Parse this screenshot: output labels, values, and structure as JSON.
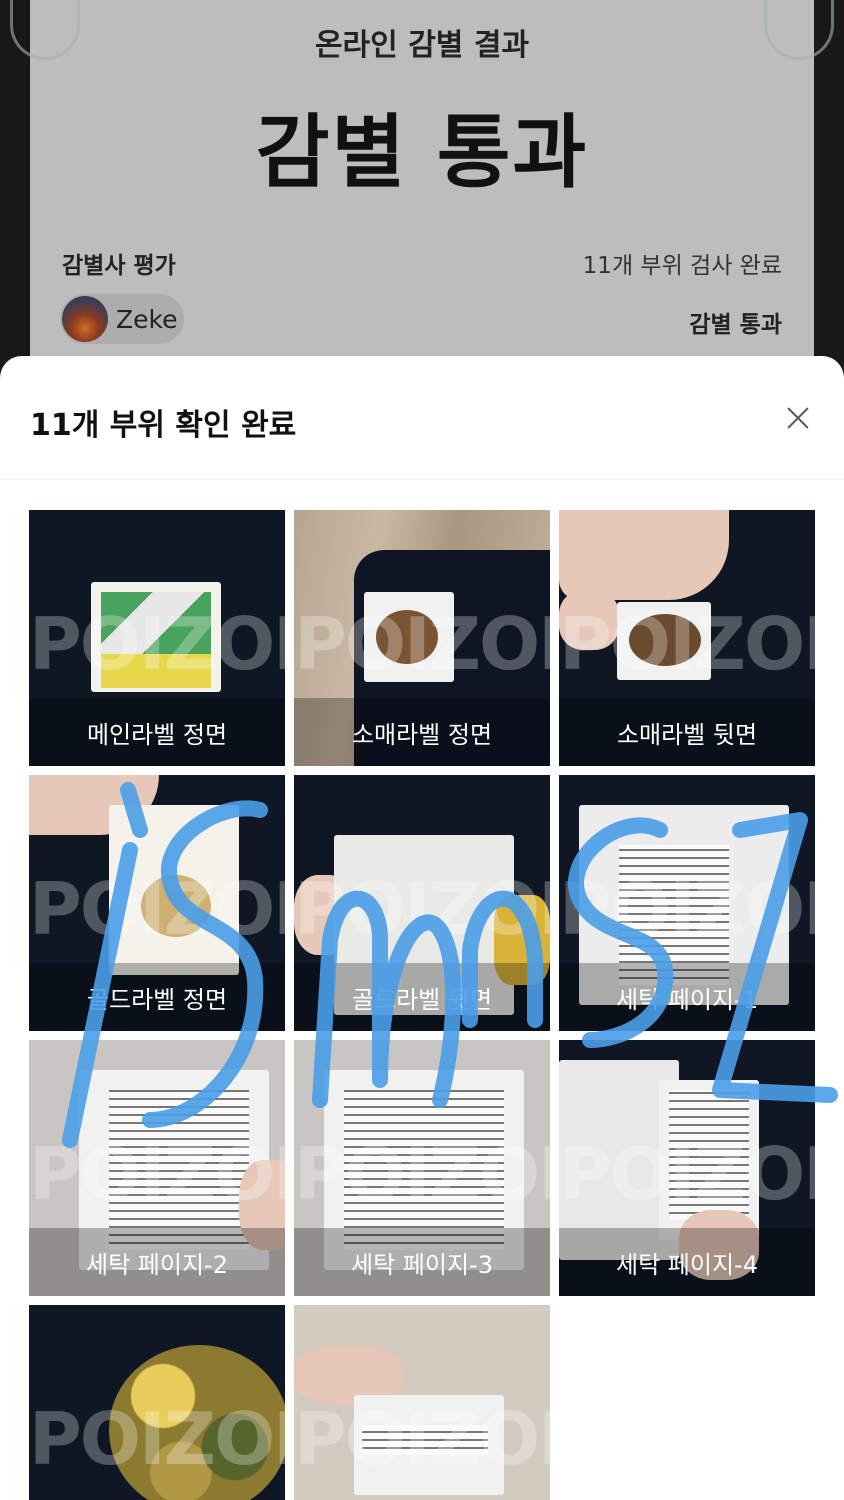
{
  "certificate": {
    "subtitle": "온라인 감별 결과",
    "title": "감별 통과",
    "evaluator_label": "감별사 평가",
    "inspection_count": "11개 부위 검사 완료",
    "evaluator_name": "Zeke",
    "result": "감별 통과"
  },
  "sheet": {
    "title": "11개 부위 확인 완료",
    "watermark": "POIZON",
    "tiles": [
      {
        "caption": "메인라벨 정면"
      },
      {
        "caption": "소매라벨 정면"
      },
      {
        "caption": "소매라벨 뒷면"
      },
      {
        "caption": "골드라벨 정면"
      },
      {
        "caption": "골드라벨 뒷면"
      },
      {
        "caption": "세탁 페이지-1"
      },
      {
        "caption": "세탁 페이지-2"
      },
      {
        "caption": "세탁 페이지-3"
      },
      {
        "caption": "세탁 페이지-4"
      },
      {
        "caption": ""
      },
      {
        "caption": ""
      }
    ]
  },
  "overlay": {
    "handwriting": "iSmns1",
    "color": "#4a9ee8"
  }
}
